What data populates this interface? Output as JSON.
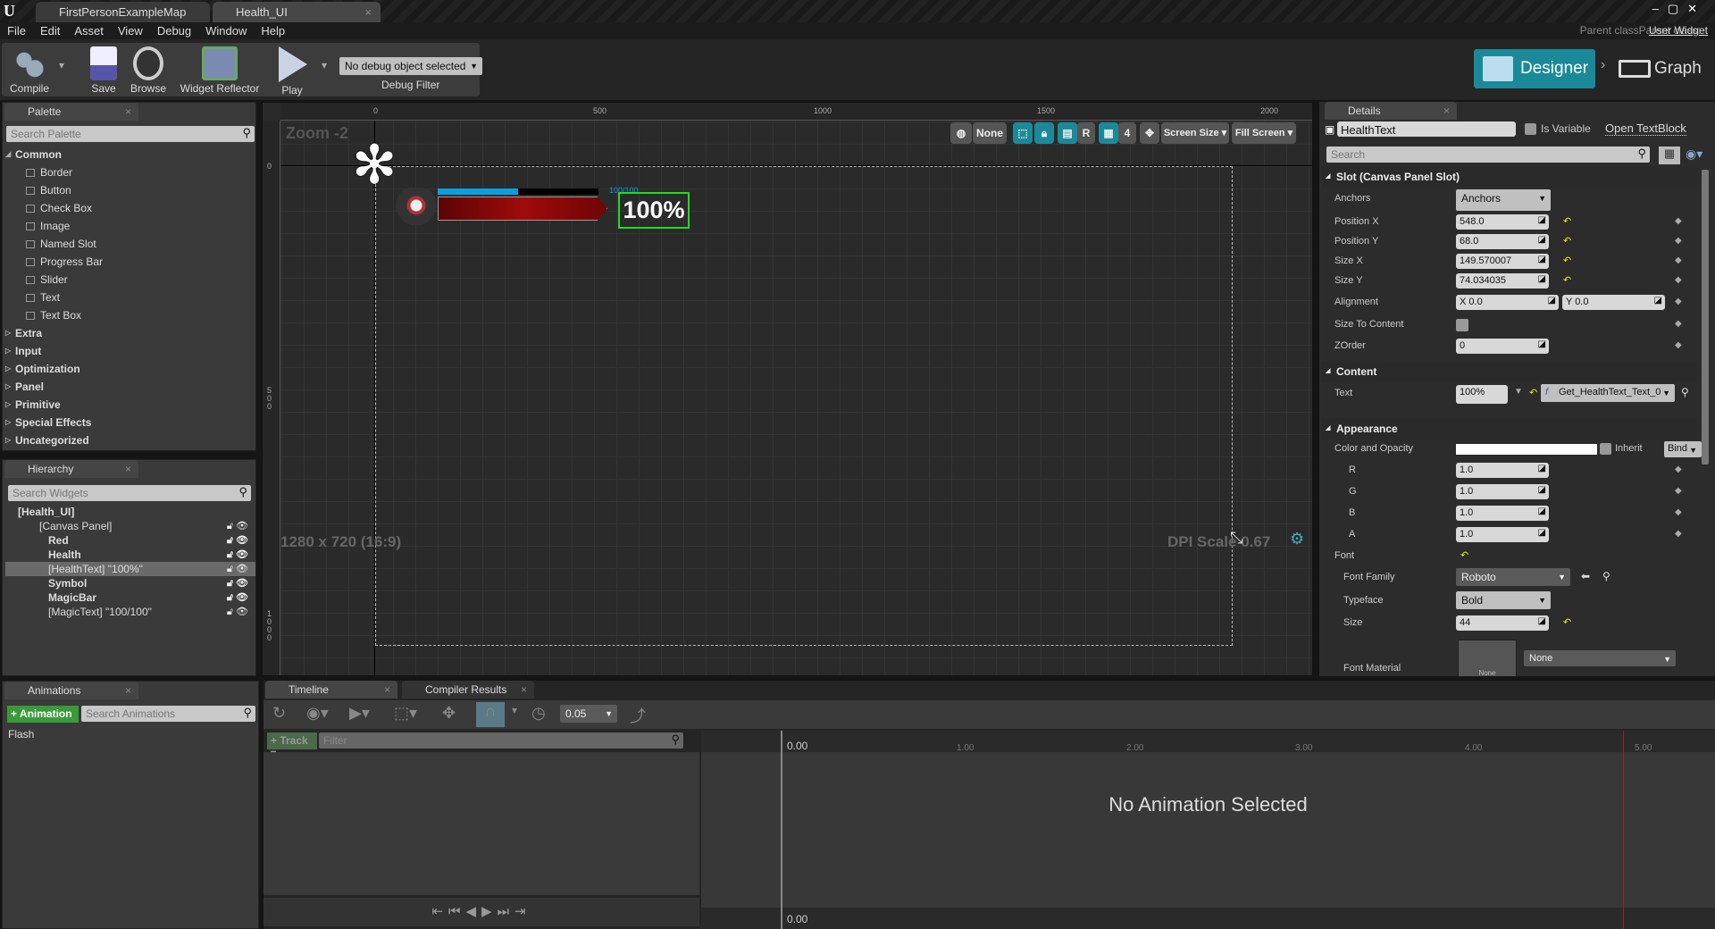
{
  "window": {
    "tabs": [
      {
        "label": "FirstPersonExampleMap"
      },
      {
        "label": "Health_UI"
      }
    ],
    "parent_class_label": "Parent class:",
    "parent_class": "User Widget"
  },
  "menu": [
    "File",
    "Edit",
    "Asset",
    "View",
    "Debug",
    "Window",
    "Help"
  ],
  "toolbar": {
    "compile": "Compile",
    "save": "Save",
    "browse": "Browse",
    "widget_reflector": "Widget Reflector",
    "play": "Play",
    "debug_object": "No debug object selected",
    "debug_filter": "Debug Filter",
    "designer": "Designer",
    "graph": "Graph"
  },
  "palette": {
    "title": "Palette",
    "search_placeholder": "Search Palette",
    "categories": [
      {
        "label": "Common",
        "open": true,
        "items": [
          "Border",
          "Button",
          "Check Box",
          "Image",
          "Named Slot",
          "Progress Bar",
          "Slider",
          "Text",
          "Text Box"
        ]
      },
      {
        "label": "Extra"
      },
      {
        "label": "Input"
      },
      {
        "label": "Optimization"
      },
      {
        "label": "Panel"
      },
      {
        "label": "Primitive"
      },
      {
        "label": "Special Effects"
      },
      {
        "label": "Uncategorized"
      }
    ]
  },
  "hierarchy": {
    "title": "Hierarchy",
    "search_placeholder": "Search Widgets",
    "items": [
      {
        "label": "[Health_UI]"
      },
      {
        "label": "[Canvas Panel]"
      },
      {
        "label": "Red"
      },
      {
        "label": "Health"
      },
      {
        "label": "[HealthText] \"100%\"",
        "selected": true
      },
      {
        "label": "Symbol"
      },
      {
        "label": "MagicBar"
      },
      {
        "label": "[MagicText] \"100/100\""
      }
    ]
  },
  "viewport": {
    "zoom": "Zoom -2",
    "resolution": "1280 x 720 (16:9)",
    "dpi_scale": "DPI Scale 0.67",
    "ruler_top": [
      "0",
      "500",
      "1000",
      "1500",
      "2000"
    ],
    "ruler_left": [
      "0",
      "500",
      "1000"
    ],
    "toolbar": {
      "none": "None",
      "r": "R",
      "grid": "4",
      "screen_size": "Screen Size",
      "fill_screen": "Fill Screen"
    },
    "widget": {
      "health_text": "100%",
      "magic_text": "100/100",
      "magic_percent": 0.5,
      "health_percent": 1.0
    }
  },
  "details": {
    "title": "Details",
    "name": "HealthText",
    "is_variable": "Is Variable",
    "open": "Open TextBlock",
    "search_placeholder": "Search",
    "slot": {
      "title": "Slot (Canvas Panel Slot)",
      "anchors_label": "Anchors",
      "anchors_value": "Anchors",
      "position_x_label": "Position X",
      "position_x": "548.0",
      "position_y_label": "Position Y",
      "position_y": "68.0",
      "size_x_label": "Size X",
      "size_x": "149.570007",
      "size_y_label": "Size Y",
      "size_y": "74.034035",
      "alignment_label": "Alignment",
      "alignment_x": "X  0.0",
      "alignment_y": "Y  0.0",
      "size_to_content": "Size To Content",
      "zorder_label": "ZOrder",
      "zorder": "0"
    },
    "content": {
      "title": "Content",
      "text_label": "Text",
      "text_value": "100%",
      "binding": "Get_HealthText_Text_0"
    },
    "appearance": {
      "title": "Appearance",
      "color_label": "Color and Opacity",
      "inherit": "Inherit",
      "bind": "Bind",
      "r_label": "R",
      "r": "1.0",
      "g_label": "G",
      "g": "1.0",
      "b_label": "B",
      "b": "1.0",
      "a_label": "A",
      "a": "1.0",
      "font_label": "Font",
      "font_family_label": "Font Family",
      "font_family": "Roboto",
      "typeface_label": "Typeface",
      "typeface": "Bold",
      "size_label": "Size",
      "size": "44",
      "font_material_label": "Font Material",
      "font_material_thumb": "None",
      "font_material": "None"
    }
  },
  "animations": {
    "title": "Animations",
    "add": "Animation",
    "search_placeholder": "Search Animations",
    "items": [
      "Flash"
    ]
  },
  "timeline": {
    "tabs": [
      "Timeline",
      "Compiler Results"
    ],
    "snap": "0.05",
    "track": "Track",
    "filter_placeholder": "Filter",
    "empty": "No Animation Selected",
    "ticks": [
      "0.00",
      "1.00",
      "2.00",
      "3.00",
      "4.00",
      "5.00"
    ]
  },
  "colors": {
    "accent": "#1a8a9a",
    "selection": "#22dd22",
    "magic": "#0aa0e0",
    "health": "#9a0a0a"
  }
}
